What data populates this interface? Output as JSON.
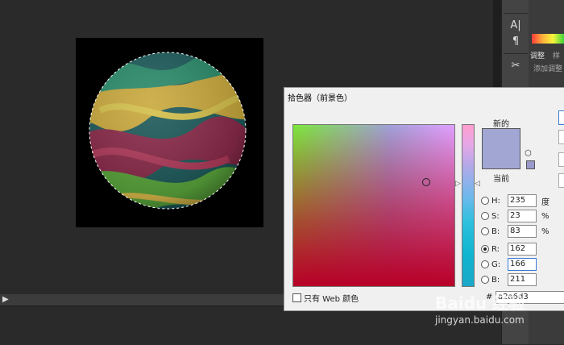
{
  "canvas": {
    "artboard_bg": "#000000"
  },
  "toolbar": {
    "tools": [
      {
        "name": "character-icon",
        "glyph": "A|"
      },
      {
        "name": "paragraph-icon",
        "glyph": "¶"
      },
      {
        "name": "tools-icon",
        "glyph": "✂"
      }
    ]
  },
  "panel": {
    "tab_adjust": "调整",
    "tab_other": "样",
    "sub_label": "添加调整"
  },
  "timeline": {
    "play_glyph": "▶"
  },
  "color_picker": {
    "title": "拾色器（前景色）",
    "label_new": "新的",
    "label_current": "当前",
    "new_color": "#a2a6d3",
    "current_color": "#a2a6d3",
    "fields": [
      {
        "id": "h",
        "label": "H:",
        "value": "235",
        "unit": "度",
        "selected": false
      },
      {
        "id": "s",
        "label": "S:",
        "value": "23",
        "unit": "%",
        "selected": false
      },
      {
        "id": "b",
        "label": "B:",
        "value": "83",
        "unit": "%",
        "selected": false
      },
      {
        "id": "r",
        "label": "R:",
        "value": "162",
        "unit": "",
        "selected": true
      },
      {
        "id": "g",
        "label": "G:",
        "value": "166",
        "unit": "",
        "selected": false
      },
      {
        "id": "bb",
        "label": "B:",
        "value": "211",
        "unit": "",
        "selected": false
      }
    ],
    "web_only_label": "只有 Web 颜色",
    "hex_hash": "#",
    "hex_value": "a2a6d3"
  },
  "watermark": {
    "text": "Baidu 经验",
    "url": "jingyan.baidu.com"
  }
}
